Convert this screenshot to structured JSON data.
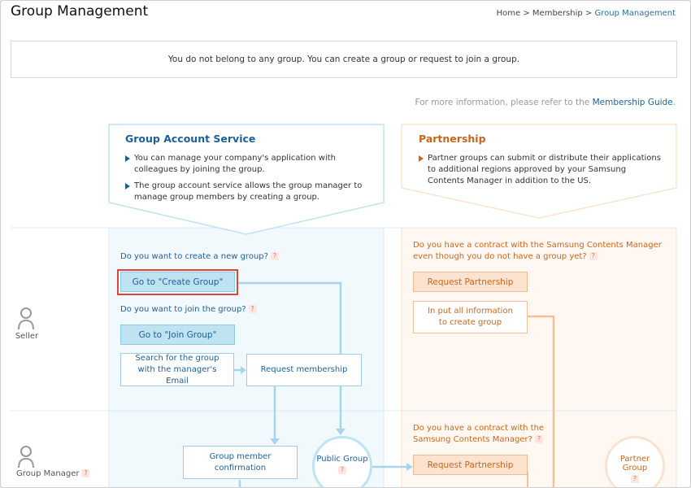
{
  "header": {
    "title": "Group Management",
    "breadcrumb": [
      "Home",
      "Membership",
      "Group Management"
    ],
    "breadcrumb_sep": ">"
  },
  "notice": "You do not belong to any group. You can create a group or request to join a group.",
  "more_info": {
    "prefix": "For more information, please refer to the",
    "link": "Membership Guide",
    "suffix": "."
  },
  "group_account_service": {
    "title": "Group Account Service",
    "bullets": [
      "You can manage your company's application with colleagues by joining the group.",
      "The group account service allows the group manager to manage group members by creating a group."
    ]
  },
  "partnership": {
    "title": "Partnership",
    "bullets": [
      "Partner groups can submit or distribute their applications to additional regions approved by your Samsung Contents Manager in addition to the US."
    ]
  },
  "roles": {
    "seller": "Seller",
    "group_manager": "Group Manager"
  },
  "seller_flow": {
    "create_question": "Do you want to create a new group?",
    "create_button": "Go to \"Create Group\"",
    "join_question": "Do you want to join the group?",
    "join_button": "Go to \"Join Group\"",
    "search_box": "Search for the group with the manager's Email",
    "request_membership": "Request membership",
    "partner_question": "Do you have a contract with the Samsung Contents Manager even though you do not have a group yet?",
    "request_partnership": "Request Partnership",
    "input_info": "In put all information to create group"
  },
  "manager_flow": {
    "member_confirmation": "Group member confirmation",
    "public_group": "Public Group",
    "partner_question": "Do you have a contract with the Samsung Contents Manager?",
    "request_partnership": "Request Partnership",
    "partner_group": "Partner Group"
  },
  "help_mark": "?",
  "colors": {
    "blue_text": "#1f5f96",
    "blue_fill": "#bfe3f1",
    "blue_bg": "#f2f9fd",
    "orange_text": "#c8661a",
    "orange_fill": "#fbe3cf",
    "orange_bg": "#fff8f2",
    "highlight": "#e0453a"
  }
}
